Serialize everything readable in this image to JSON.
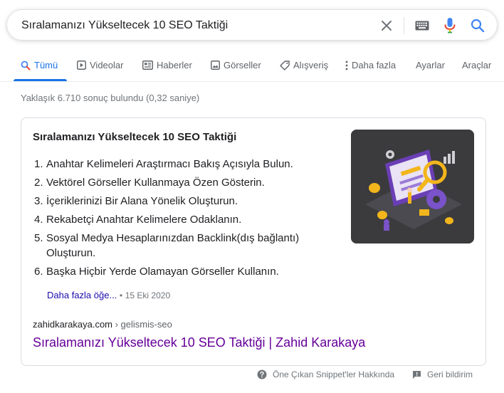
{
  "search": {
    "query": "Sıralamanızı Yükseltecek 10 SEO Taktiği",
    "icons": [
      "close-icon",
      "keyboard-icon",
      "microphone-icon",
      "search-icon"
    ]
  },
  "tabs": {
    "items": [
      {
        "label": "Tümü",
        "icon": "search-icon",
        "active": true
      },
      {
        "label": "Videolar",
        "icon": "play-icon"
      },
      {
        "label": "Haberler",
        "icon": "news-icon"
      },
      {
        "label": "Görseller",
        "icon": "image-icon"
      },
      {
        "label": "Alışveriş",
        "icon": "tag-icon"
      },
      {
        "label": "Daha fazla",
        "icon": "more-vertical-icon"
      }
    ],
    "settings": "Ayarlar",
    "tools": "Araçlar"
  },
  "stats": "Yaklaşık 6.710 sonuç bulundu (0,32 saniye)",
  "snippet": {
    "title": "Sıralamanızı Yükseltecek 10 SEO Taktiği",
    "items": [
      {
        "num": "1.",
        "text": "Anahtar Kelimeleri Araştırmacı Bakış Açısıyla Bulun."
      },
      {
        "num": "2.",
        "text": "Vektörel Görseller Kullanmaya Özen Gösterin."
      },
      {
        "num": "3.",
        "text": "İçeriklerinizi Bir Alana Yönelik Oluşturun."
      },
      {
        "num": "4.",
        "text": "Rekabetçi Anahtar Kelimelere Odaklanın."
      },
      {
        "num": "5.",
        "text": "Sosyal Medya Hesaplarınızdan Backlink(dış bağlantı) Oluşturun."
      },
      {
        "num": "6.",
        "text": "Başka Hiçbir Yerde Olamayan Görseller Kullanın."
      }
    ],
    "more_link": "Daha fazla öğe...",
    "separator": "•",
    "date": "15 Eki 2020",
    "cite_domain": "zahidkarakaya.com",
    "cite_path": " › gelismis-seo",
    "result_title": "Sıralamanızı Yükseltecek 10 SEO Taktiği | Zahid Karakaya"
  },
  "footer": {
    "about": "Öne Çıkan Snippet'ler Hakkında",
    "feedback": "Geri bildirim"
  },
  "colors": {
    "accent": "#1a73e8",
    "link": "#1a0dab",
    "visited": "#660099",
    "muted": "#70757a"
  }
}
